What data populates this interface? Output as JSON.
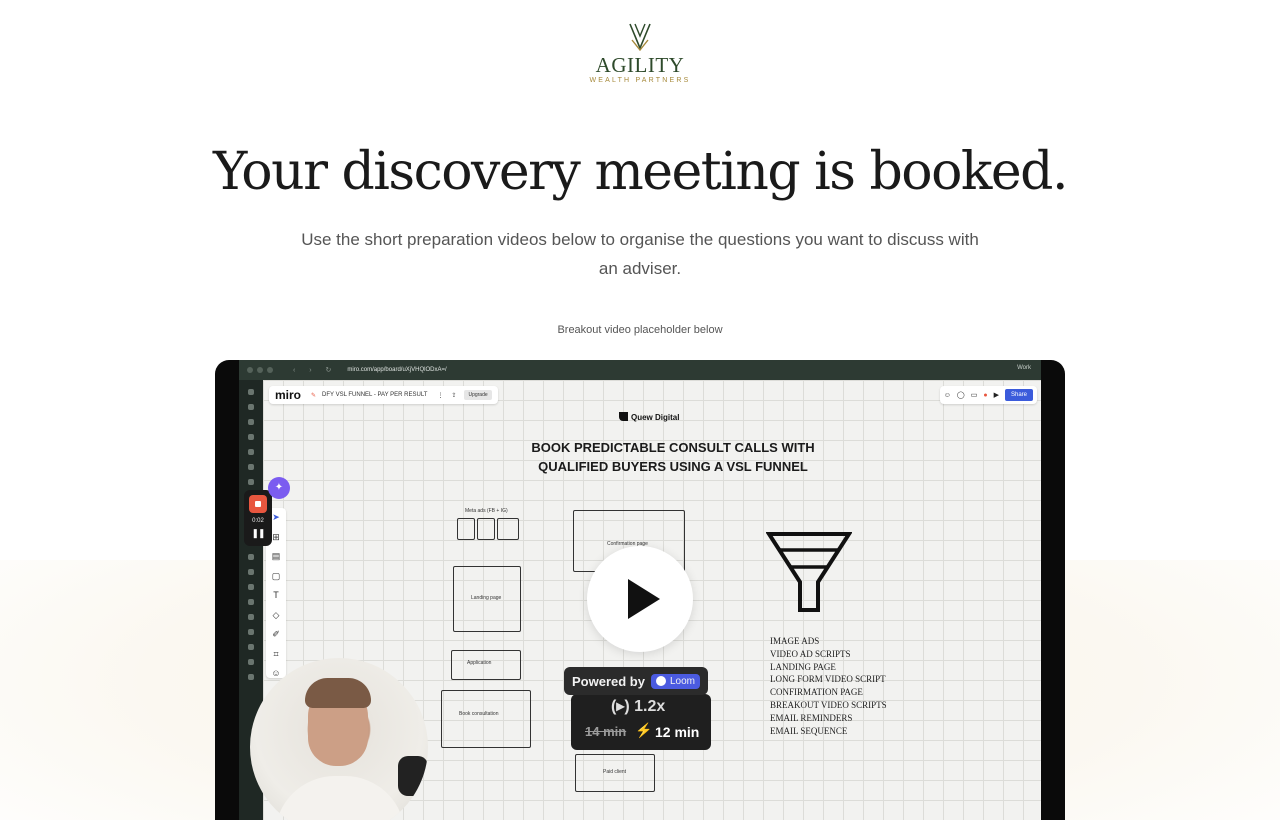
{
  "brand": {
    "name": "AGILITY",
    "subname": "WEALTH PARTNERS",
    "colors": {
      "primary": "#2e4a2b",
      "accent": "#a6893a"
    }
  },
  "hero": {
    "headline": "Your discovery meeting is booked.",
    "subtitle": "Use the short preparation videos below to organise the questions you want to discuss with an adviser.",
    "placeholder_label": "Breakout video placeholder below"
  },
  "video": {
    "browser": {
      "url": "miro.com/app/board/uXjVHQlODxA=/",
      "profile": "Work"
    },
    "miro": {
      "logo": "miro",
      "board_name": "DFY VSL FUNNEL - PAY PER RESULT",
      "upgrade_label": "Upgrade",
      "share_label": "Share",
      "brand_small": "Quew Digital",
      "board_title_line1": "BOOK PREDICTABLE CONSULT CALLS WITH",
      "board_title_line2": "QUALIFIED BUYERS USING A VSL FUNNEL",
      "sketch_labels": [
        "Meta ads (FB + IG)",
        "Landing page",
        "Application",
        "Book consultation",
        "Confirmation page",
        "Paid client"
      ],
      "funnel_items": [
        "IMAGE ADS",
        "VIDEO AD SCRIPTS",
        "LANDING PAGE",
        "LONG FORM VIDEO SCRIPT",
        "CONFIRMATION PAGE",
        "BREAKOUT VIDEO SCRIPTS",
        "EMAIL REMINDERS",
        "EMAIL SEQUENCE"
      ]
    },
    "recorder": {
      "time": "0:02"
    },
    "loom": {
      "powered_by": "Powered by",
      "loom_label": "Loom",
      "speed_label": "(▸) 1.2x",
      "old_duration": "14 min",
      "new_duration": "12 min"
    }
  }
}
